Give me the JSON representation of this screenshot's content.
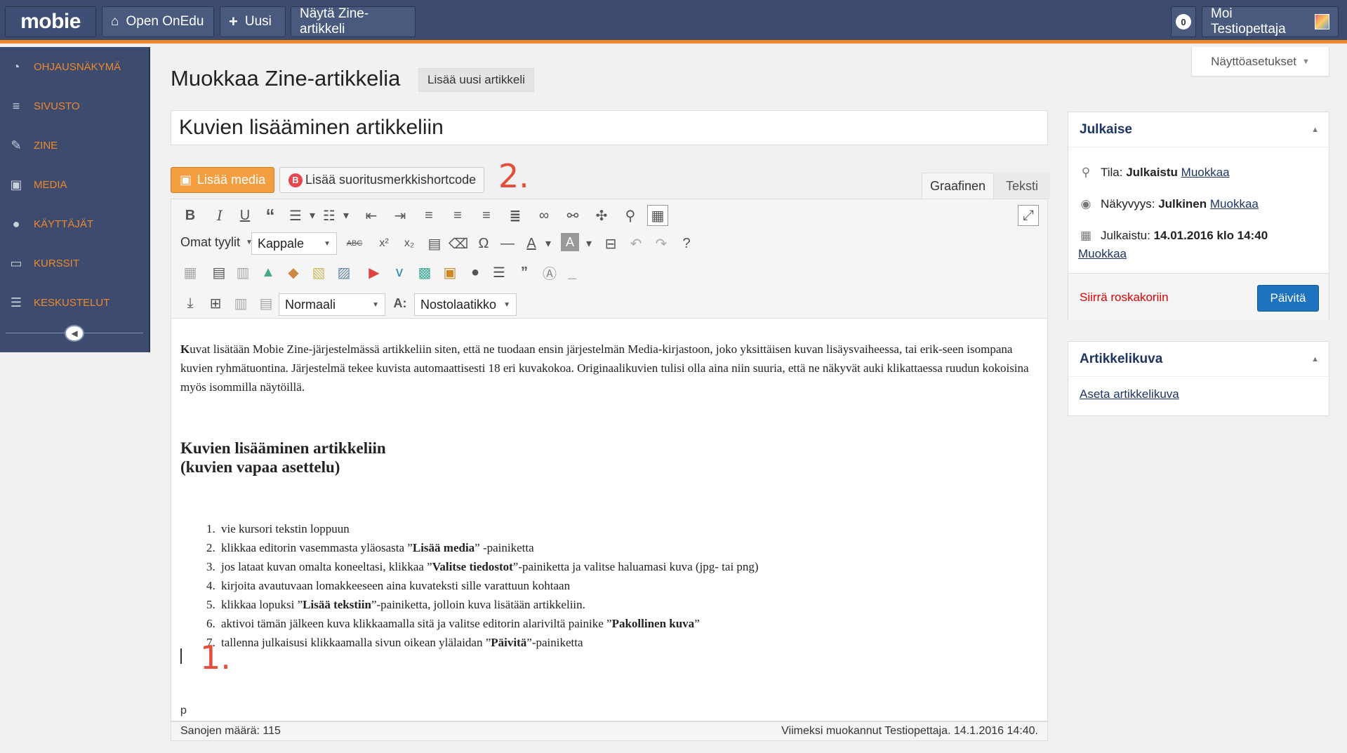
{
  "topbar": {
    "logo": "mobie",
    "open_onedu": "Open OnEdu",
    "new": "Uusi",
    "view_zine": "Näytä Zine-artikkeli",
    "notifications": "0",
    "greeting": "Moi Testiopettaja"
  },
  "sidebar": {
    "items": [
      {
        "label": "OHJAUSNÄKYMÄ",
        "icon": "dashboard-icon"
      },
      {
        "label": "SIVUSTO",
        "icon": "lines-icon"
      },
      {
        "label": "ZINE",
        "icon": "pin-icon"
      },
      {
        "label": "MEDIA",
        "icon": "media-icon"
      },
      {
        "label": "KÄYTTÄJÄT",
        "icon": "user-icon"
      },
      {
        "label": "KURSSIT",
        "icon": "monitor-icon"
      },
      {
        "label": "KESKUSTELUT",
        "icon": "discussion-icon"
      }
    ]
  },
  "header": {
    "title": "Muokkaa Zine-artikkelia",
    "add_new": "Lisää uusi artikkeli",
    "screen_options": "Näyttöasetukset"
  },
  "post": {
    "title": "Kuvien lisääminen artikkeliin"
  },
  "media_buttons": {
    "add_media": "Lisää media",
    "add_badge": "Lisää suoritusmerkkishortcode",
    "badge_letter": "B"
  },
  "annotations": {
    "one": "1.",
    "two": "2."
  },
  "editor_tabs": {
    "visual": "Graafinen",
    "text": "Teksti"
  },
  "toolbar": {
    "styles": "Omat tyylit",
    "format": "Kappale",
    "font_size": "Normaali",
    "font_family": "Nostolaatikko"
  },
  "content": {
    "lead_bold": "K",
    "lead": "uvat lisätään Mobie Zine-järjestelmässä artikkeliin siten, että ne tuodaan ensin järjestelmän Media-kirjastoon, joko yksittäisen kuvan lisäysvaiheessa, tai erik-seen isompana kuvien ryhmätuontina. Järjestelmä tekee kuvista automaattisesti 18 eri kuvakokoa. Originaalikuvien tulisi olla aina niin suuria, että ne näkyvät auki klikattaessa ruudun kokoisina myös isommilla näytöillä.",
    "heading_line1": "Kuvien lisääminen artikkeliin",
    "heading_line2": "(kuvien vapaa asettelu)",
    "steps": [
      {
        "pre": "vie kursori tekstin loppuun",
        "bold": "",
        "post": ""
      },
      {
        "pre": "klikkaa editorin vasemmasta yläosasta ”",
        "bold": "Lisää media",
        "post": "” -painiketta"
      },
      {
        "pre": "jos lataat kuvan omalta koneeltasi, klikkaa ”",
        "bold": "Valitse tiedostot",
        "post": "”-painiketta ja valitse haluamasi kuva (jpg- tai png)"
      },
      {
        "pre": "kirjoita avautuvaan lomakkeeseen aina kuvateksti sille varattuun kohtaan",
        "bold": "",
        "post": ""
      },
      {
        "pre": "klikkaa lopuksi ”",
        "bold": "Lisää tekstiin",
        "post": "”-painiketta, jolloin kuva lisätään artikkeliin."
      },
      {
        "pre": "aktivoi tämän jälkeen kuva klikkaamalla sitä ja valitse editorin alariviltä painike ”",
        "bold": "Pakollinen kuva",
        "post": "”"
      },
      {
        "pre": "tallenna julkaisusi klikkaamalla sivun oikean ylälaidan ”",
        "bold": "Päivitä",
        "post": "”-painiketta"
      }
    ]
  },
  "editor_footer": {
    "path": "p",
    "word_count": "Sanojen määrä: 115",
    "last_edited": "Viimeksi muokannut Testiopettaja. 14.1.2016 14:40."
  },
  "publish": {
    "title": "Julkaise",
    "status_label": "Tila: ",
    "status_value": "Julkaistu",
    "status_edit": "Muokkaa",
    "visibility_label": "Näkyvyys: ",
    "visibility_value": "Julkinen",
    "visibility_edit": "Muokkaa",
    "published_label": "Julkaistu: ",
    "published_value": "14.01.2016 klo 14:40",
    "published_edit": "Muokkaa",
    "trash": "Siirrä roskakoriin",
    "update": "Päivitä"
  },
  "featured": {
    "title": "Artikkelikuva",
    "set": "Aseta artikkelikuva"
  },
  "colors": {
    "topbar": "#3c4b6e",
    "accent_orange": "#f0882b",
    "primary_blue": "#1e73be",
    "annotation_red": "#e44d3a"
  }
}
